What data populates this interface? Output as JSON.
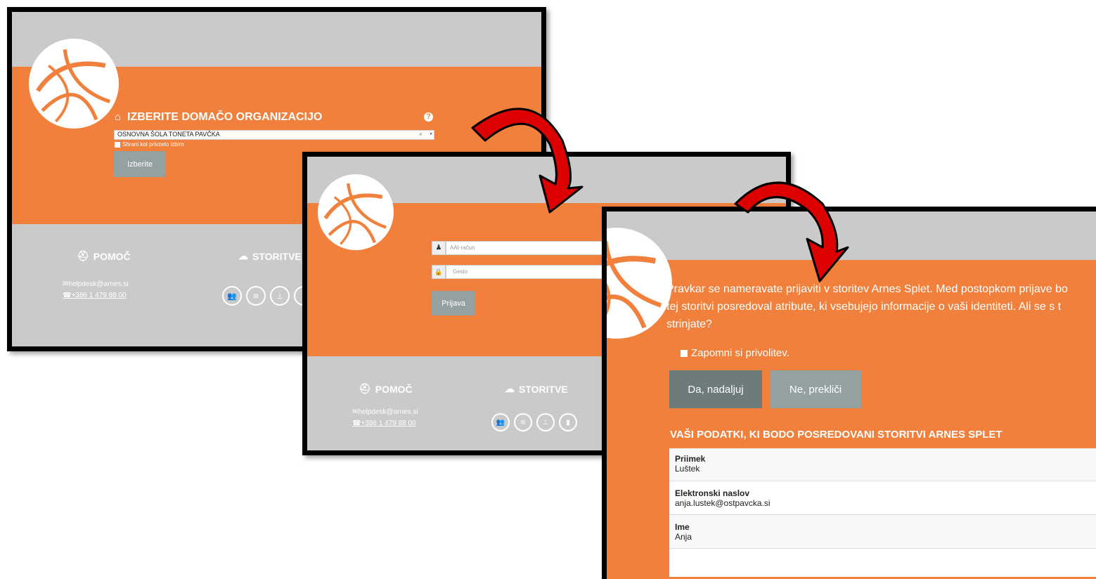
{
  "colors": {
    "orange": "#f0803c",
    "grey": "#cacaca",
    "button": "#95a1a0",
    "button_dark": "#6d7c7b",
    "arrow": "#dd0000"
  },
  "screen1": {
    "heading": "IZBERITE DOMAČO ORGANIZACIJO",
    "select_value": "OSNOVNA ŠOLA TONETA PAVČKA",
    "remember_label": "Shrani kot privzeto izbiro",
    "submit_label": "Izberite",
    "help_title": "POMOČ",
    "services_title": "STORITVE",
    "email": "helpdesk@arnes.si",
    "phone": "+386 1 479 88 00"
  },
  "screen2": {
    "username_placeholder": "AAI-račun",
    "password_placeholder": "Geslo",
    "login_label": "Prijava",
    "help_title": "POMOČ",
    "services_title": "STORITVE",
    "email": "helpdesk@arnes.si",
    "phone": "+386 1 479 88 00"
  },
  "screen3": {
    "consent_line1": "Pravkar se nameravate prijaviti v storitev Arnes Splet. Med postopkom prijave bo",
    "consent_line2": "tej storitvi posredoval atribute, ki vsebujejo informacije o vaši identiteti. Ali se s t",
    "consent_line3": "strinjate?",
    "remember_label": "Zapomni si privolitev.",
    "yes_label": "Da, nadaljuj",
    "no_label": "Ne, prekliči",
    "attributes_heading": "VAŠI PODATKI, KI BODO POSREDOVANI STORITVI ARNES SPLET",
    "attributes": [
      {
        "label": "Priimek",
        "value": "Luštek"
      },
      {
        "label": "Elektronski naslov",
        "value": "anja.lustek@ostpavcka.si"
      },
      {
        "label": "Ime",
        "value": "Anja"
      }
    ]
  }
}
